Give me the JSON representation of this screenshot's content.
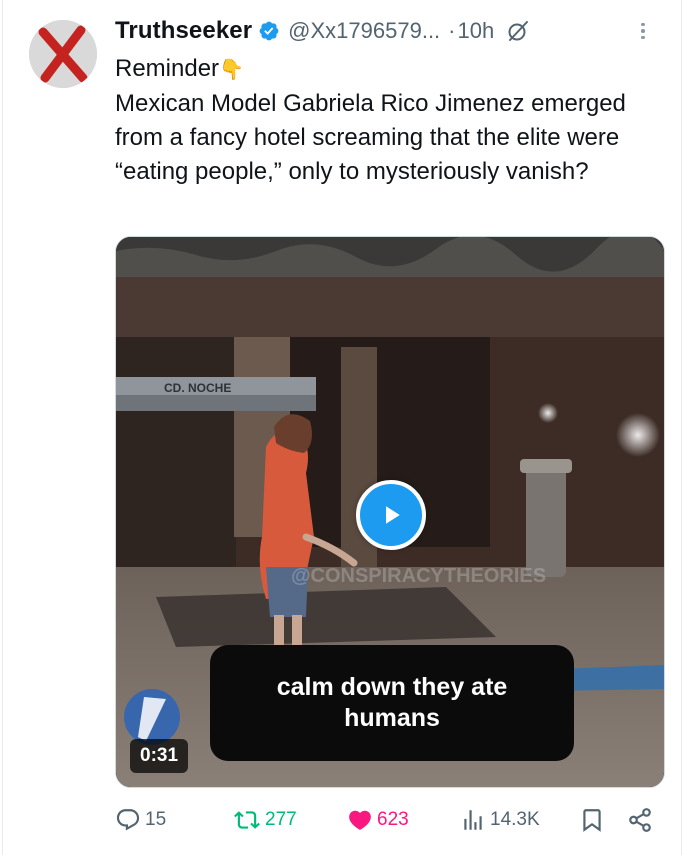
{
  "author": {
    "display_name": "Truthseeker",
    "handle": "@Xx1796579...",
    "time_separator": "·",
    "time": "10h",
    "verified": true
  },
  "post": {
    "lines": [
      "Reminder",
      "Mexican Model Gabriela Rico Jimenez emerged from a fancy hotel screaming that the elite were “eating people,” only to mysteriously vanish?"
    ],
    "reminder_emoji": "👇"
  },
  "video": {
    "caption": "calm down they ate humans",
    "duration": "0:31",
    "sign_text": "CD. NOCHE",
    "watermark": "@CONSPIRACYTHEORIES"
  },
  "actions": {
    "replies": "15",
    "reposts": "277",
    "likes": "623",
    "views": "14.3K",
    "liked": true
  },
  "colors": {
    "accent": "#1d9bf0",
    "repost": "#00ba7c",
    "like": "#f91880",
    "muted": "#536471"
  },
  "icons": [
    "verified-badge-icon",
    "grok-icon",
    "more-icon",
    "play-icon",
    "reply-icon",
    "retweet-icon",
    "heart-icon",
    "views-icon",
    "bookmark-icon",
    "share-icon"
  ]
}
